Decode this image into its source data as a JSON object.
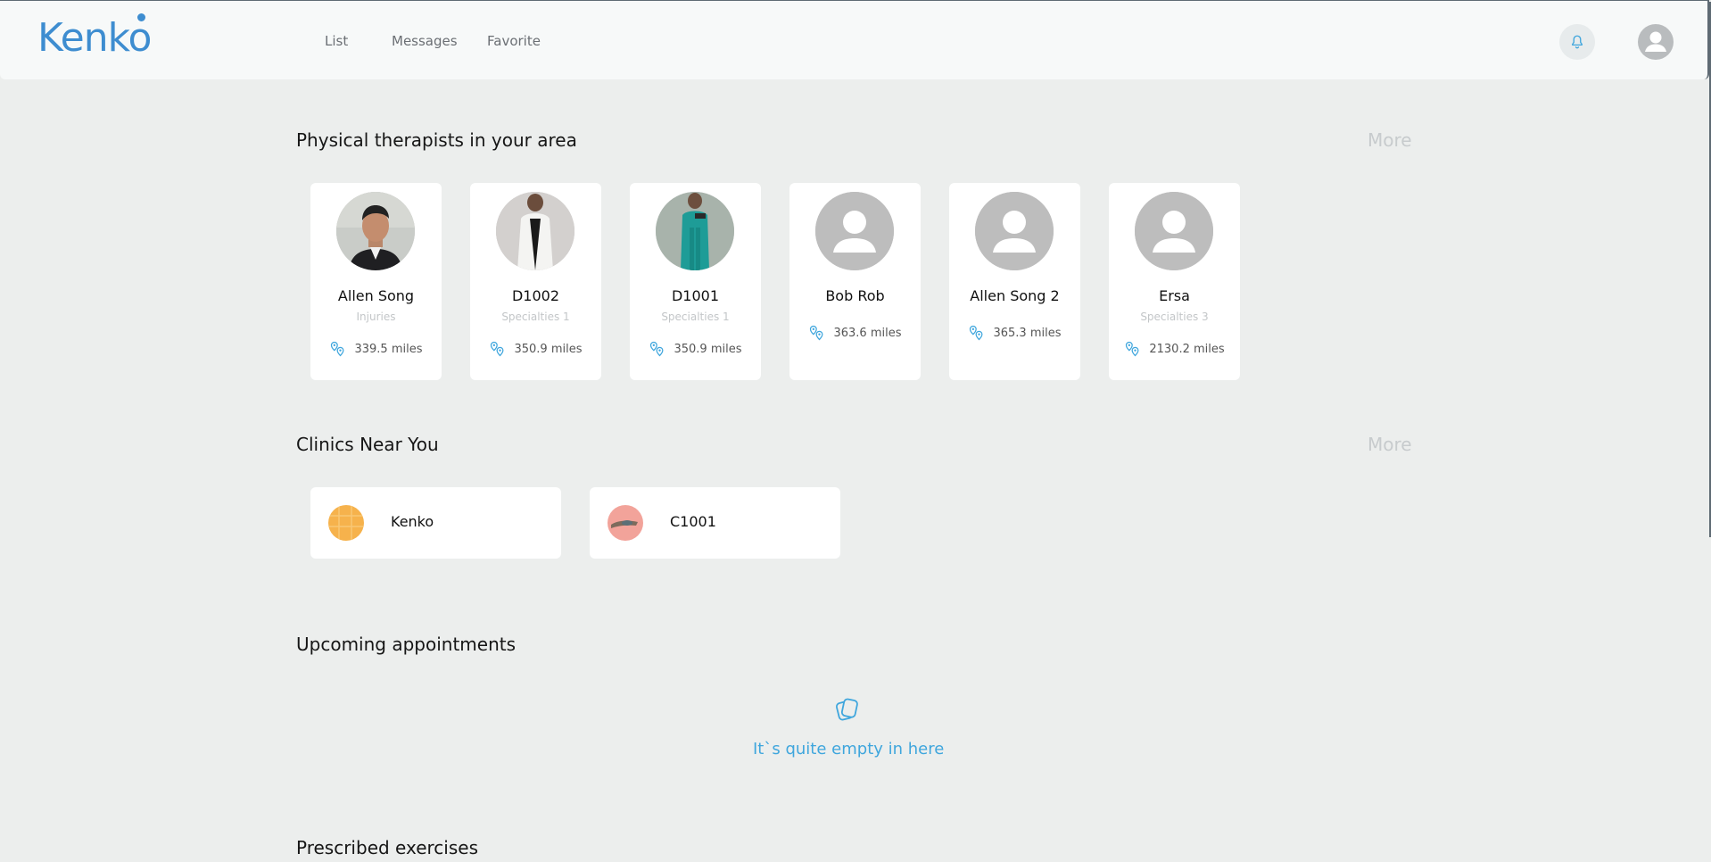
{
  "header": {
    "logo_text": "Kenko",
    "nav": [
      {
        "label": "List"
      },
      {
        "label": "Messages"
      },
      {
        "label": "Favorite"
      }
    ],
    "icons": [
      "bell-icon",
      "user-avatar-icon"
    ]
  },
  "colors": {
    "brand": "#3e8dd0",
    "accent": "#3fa6dd",
    "muted": "#c7cbcd",
    "background": "#eceeed"
  },
  "therapists": {
    "title": "Physical therapists in your area",
    "more_label": "More",
    "items": [
      {
        "name": "Allen Song",
        "specialty": "Injuries",
        "distance": "339.5 miles",
        "photo": "portrait"
      },
      {
        "name": "D1002",
        "specialty": "Specialties 1",
        "distance": "350.9 miles",
        "photo": "white-coat"
      },
      {
        "name": "D1001",
        "specialty": "Specialties 1",
        "distance": "350.9 miles",
        "photo": "scrubs"
      },
      {
        "name": "Bob Rob",
        "specialty": "",
        "distance": "363.6 miles",
        "photo": "placeholder"
      },
      {
        "name": "Allen Song 2",
        "specialty": "",
        "distance": "365.3 miles",
        "photo": "placeholder"
      },
      {
        "name": "Ersa",
        "specialty": "Specialties 3",
        "distance": "2130.2 miles",
        "photo": "placeholder"
      }
    ]
  },
  "clinics": {
    "title": "Clinics Near You",
    "more_label": "More",
    "items": [
      {
        "name": "Kenko"
      },
      {
        "name": "C1001"
      }
    ]
  },
  "appointments": {
    "title": "Upcoming appointments",
    "empty_text": "It`s quite empty in here"
  },
  "exercises": {
    "title": "Prescribed exercises"
  }
}
